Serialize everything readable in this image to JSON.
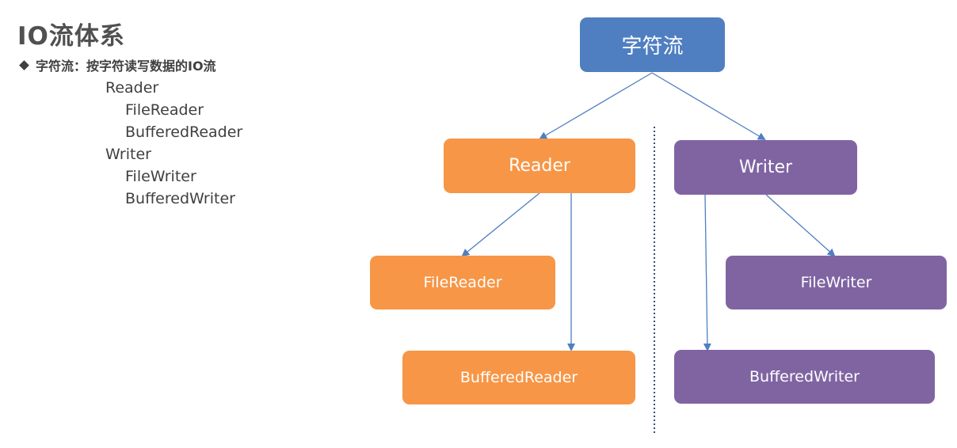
{
  "page": {
    "title": "IO流体系",
    "bullet": "字符流：按字符读写数据的IO流",
    "tree": [
      {
        "label": "Reader"
      },
      {
        "label": "FileReader"
      },
      {
        "label": "BufferedReader"
      },
      {
        "label": "Writer"
      },
      {
        "label": "FileWriter"
      },
      {
        "label": "BufferedWriter"
      }
    ]
  },
  "diagram": {
    "root": {
      "label": "字符流",
      "color": "#4f7fc1"
    },
    "reader": {
      "label": "Reader",
      "color": "#f79646"
    },
    "file_reader": {
      "label": "FileReader",
      "color": "#f79646"
    },
    "buffered_reader": {
      "label": "BufferedReader",
      "color": "#f79646"
    },
    "writer": {
      "label": "Writer",
      "color": "#8064a2"
    },
    "file_writer": {
      "label": "FileWriter",
      "color": "#8064a2"
    },
    "buffered_writer": {
      "label": "BufferedWriter",
      "color": "#8064a2"
    },
    "arrow_color": "#4f7fc1",
    "divider_color": "#2f4f7f"
  }
}
